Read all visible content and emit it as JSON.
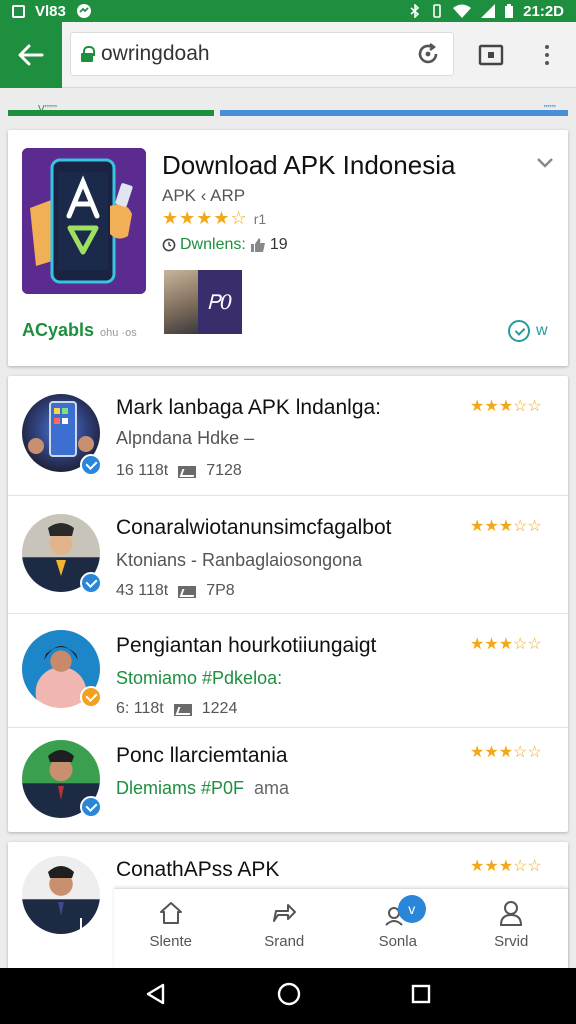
{
  "status_bar": {
    "left_text": "Vl83",
    "time": "21:2D"
  },
  "browser": {
    "url": "owringdoah"
  },
  "tabs": {
    "left_label": "V’’’’’’",
    "right_label": "’’’’’’"
  },
  "hero": {
    "title": "Download APK Indonesia",
    "subtitle": "APK ‹ ARP",
    "stars": "★★★★☆",
    "rating_count": "r1",
    "downloads_label": "Dwnlens:",
    "downloads_value": "19",
    "thumb_text": "Ꮲ0",
    "brand": "ACyabls",
    "brand_small": "ohu ·os",
    "cta_text": "w"
  },
  "list": {
    "rows": [
      {
        "title": "Mark lanbaga APK lndanlga:",
        "subtitle": "Alpndana Hdke –",
        "meta_left": "16 118t",
        "meta_right": "7128",
        "stars": "★★★☆☆"
      },
      {
        "title": "Conaralwiotanunsimcfagalbot",
        "subtitle": "Ktonians - Ranbaglaiosongona",
        "meta_left": "43 118t",
        "meta_right": "7P8",
        "stars": "★★★☆☆"
      },
      {
        "title": "Pengiantan hourkotiiungaigt",
        "subtitle": "Stomiamo #Pdkeloa:",
        "meta_left": "6: 118t",
        "meta_right": "1224",
        "stars": "★★★☆☆"
      },
      {
        "title": "Ponc llarciemtania",
        "subtitle": "Dlemiams #P0F",
        "subtitle_extra": "ama",
        "stars": "★★★☆☆"
      }
    ]
  },
  "last_item": {
    "title": "ConathAPss APK",
    "stars": "★★★☆☆"
  },
  "bottom_nav": {
    "items": [
      {
        "label": "Slente"
      },
      {
        "label": "Srand"
      },
      {
        "label": "Sonla",
        "badge": "v"
      },
      {
        "label": "Srvid"
      }
    ]
  }
}
